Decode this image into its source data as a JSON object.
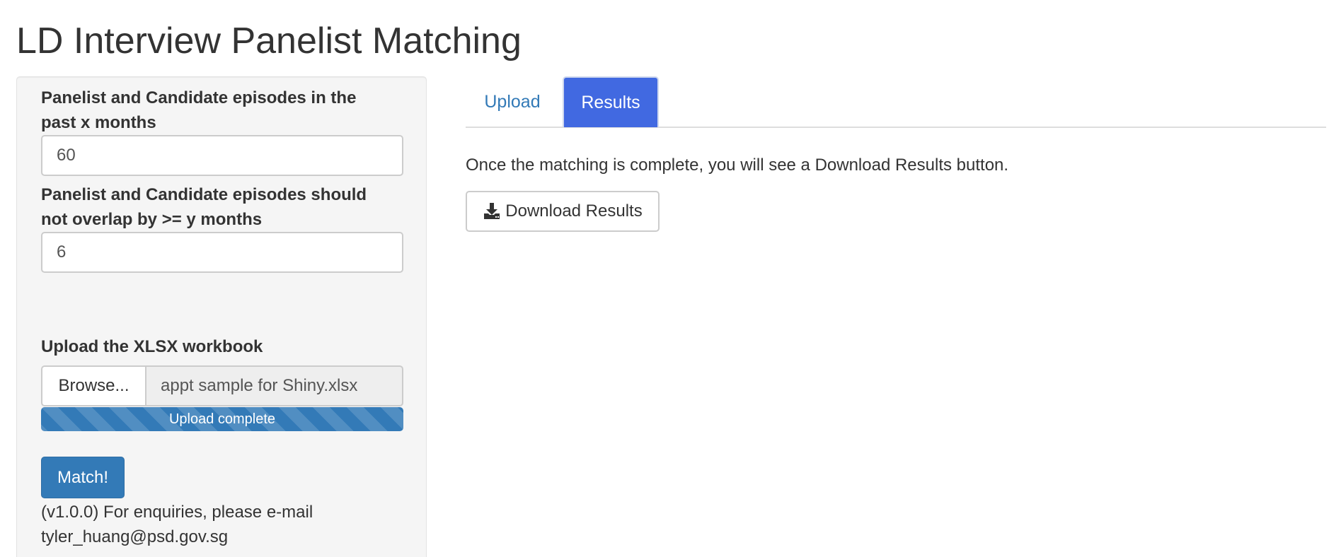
{
  "app": {
    "title": "LD Interview Panelist Matching"
  },
  "sidebar": {
    "months_label": "Panelist and Candidate episodes in the past x months",
    "months_value": "60",
    "overlap_label": "Panelist and Candidate episodes should not overlap by >= y months",
    "overlap_value": "6",
    "upload_label": "Upload the XLSX workbook",
    "browse_label": "Browse...",
    "file_name": "appt sample for Shiny.xlsx",
    "progress_text": "Upload complete",
    "progress_fraction": 1.0,
    "match_label": "Match!",
    "footer_note": "(v1.0.0) For enquiries, please e-mail tyler_huang@psd.gov.sg"
  },
  "tabs": [
    {
      "label": "Upload",
      "active": false
    },
    {
      "label": "Results",
      "active": true
    }
  ],
  "results": {
    "message": "Once the matching is complete, you will see a Download Results button.",
    "download_label": "Download Results",
    "download_icon": "download-icon"
  },
  "colors": {
    "primary": "#337ab7",
    "active_tab": "#4169e1",
    "sidebar_bg": "#f5f5f5"
  }
}
